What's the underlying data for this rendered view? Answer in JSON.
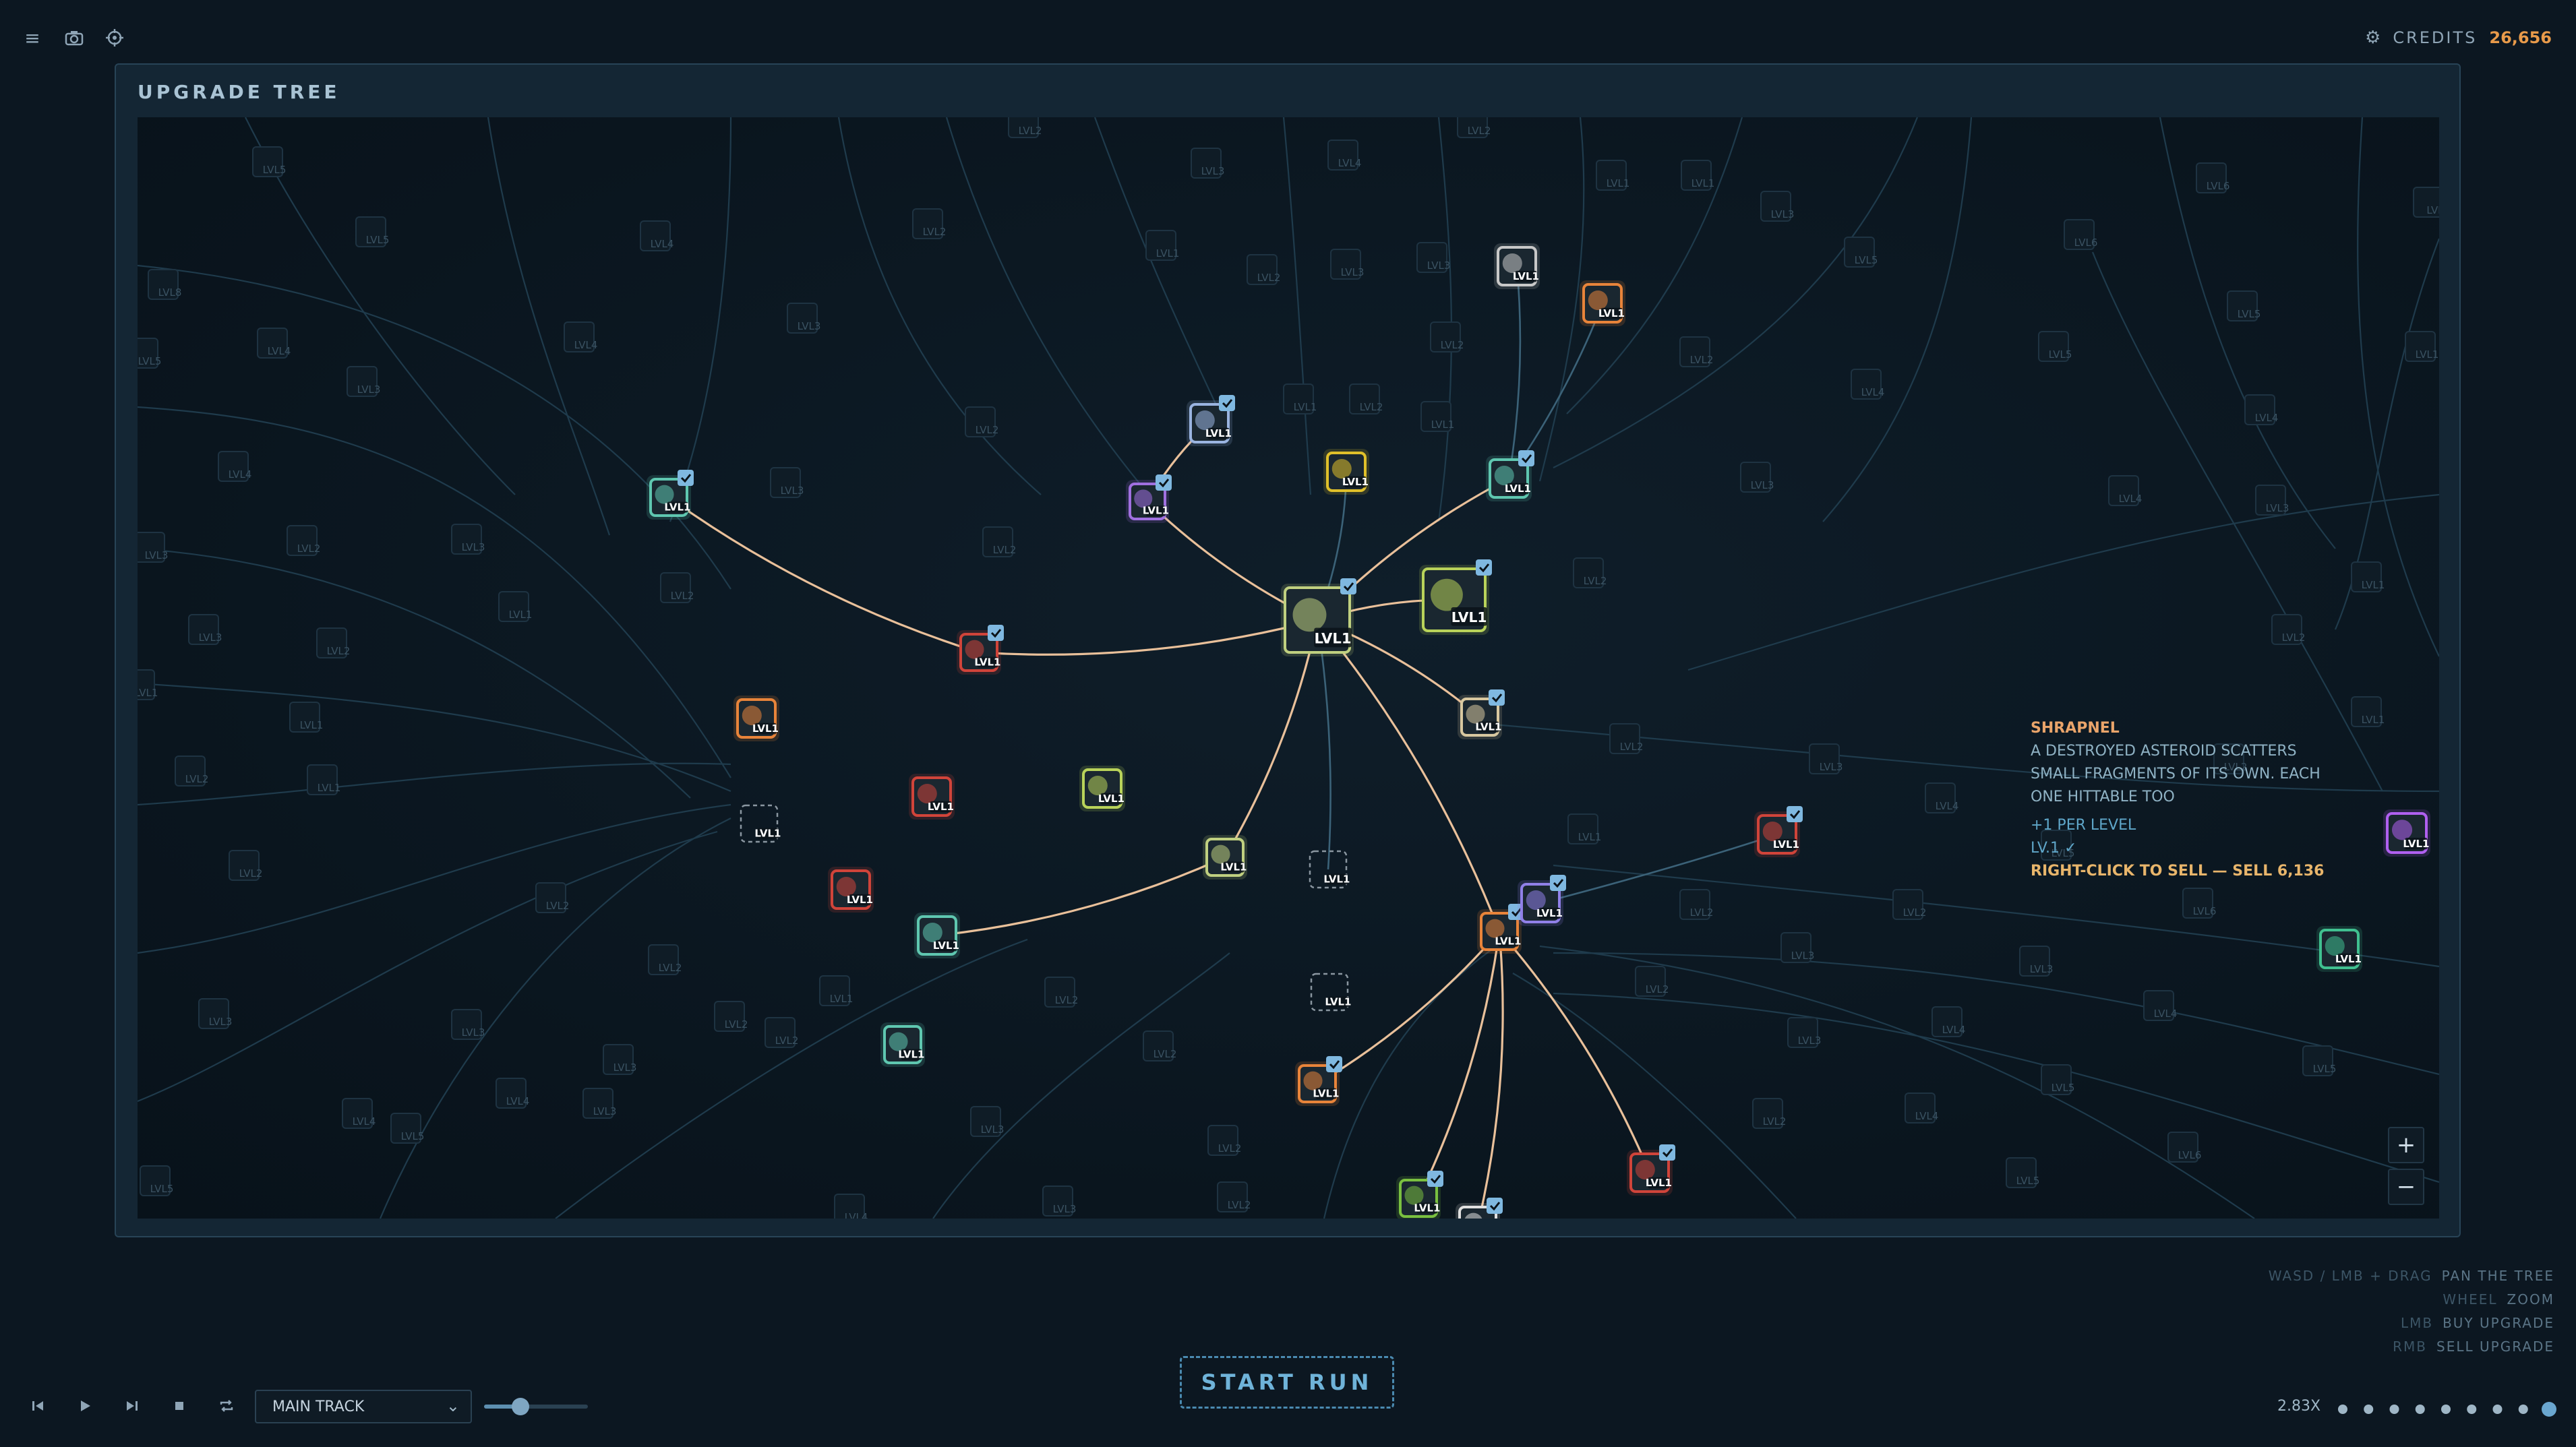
{
  "toolbar": {
    "menu_icon": "menu-icon",
    "camera_icon": "camera-icon",
    "target_icon": "crosshair-icon",
    "credits_label": "CREDITS",
    "credits_value": "26,656",
    "credits_icon": "gear-icon"
  },
  "panel": {
    "title": "UPGRADE TREE"
  },
  "tree": {
    "core": {
      "level": "LVL1"
    },
    "upgrades": [
      {
        "id": "large-green",
        "level": "LVL1",
        "color": "#b9d35a",
        "owned": true
      },
      {
        "id": "top-gray",
        "level": "LVL1",
        "color": "#c8c8c8",
        "owned": false
      },
      {
        "id": "top-orange",
        "level": "LVL1",
        "color": "#e8843a",
        "owned": false
      },
      {
        "id": "purple-left",
        "level": "LVL1",
        "color": "#a070e0",
        "owned": true
      },
      {
        "id": "blue-top",
        "level": "LVL1",
        "color": "#9ab4e0",
        "owned": true
      },
      {
        "id": "gold",
        "level": "LVL1",
        "color": "#e0c02a",
        "owned": false
      },
      {
        "id": "teal-right",
        "level": "LVL1",
        "color": "#5fc7b0",
        "owned": true
      },
      {
        "id": "teal-left",
        "level": "LVL1",
        "color": "#5fc7b0",
        "owned": true
      },
      {
        "id": "red-mid-left",
        "level": "LVL1",
        "color": "#d0443a",
        "owned": true
      },
      {
        "id": "orange-left",
        "level": "LVL1",
        "color": "#e8843a",
        "owned": false
      },
      {
        "id": "red-center",
        "level": "LVL1",
        "color": "#d0443a",
        "owned": false
      },
      {
        "id": "green-small",
        "level": "LVL1",
        "color": "#b9d35a",
        "owned": false
      },
      {
        "id": "dashed-1",
        "level": "LVL1",
        "color": "#8a96a0",
        "owned": false
      },
      {
        "id": "red-lower",
        "level": "LVL1",
        "color": "#d0443a",
        "owned": false
      },
      {
        "id": "olive-hub",
        "level": "LVL1",
        "color": "#c0d080",
        "owned": false
      },
      {
        "id": "teal-lower",
        "level": "LVL1",
        "color": "#5fc7b0",
        "owned": false
      },
      {
        "id": "teal-bottom",
        "level": "LVL1",
        "color": "#5fc7b0",
        "owned": false
      },
      {
        "id": "beige-right",
        "level": "LVL1",
        "color": "#d8c8a0",
        "owned": true
      },
      {
        "id": "dashed-2",
        "level": "LVL1",
        "color": "#8a96a0",
        "owned": false
      },
      {
        "id": "dashed-3",
        "level": "LVL1",
        "color": "#8a96a0",
        "owned": false
      },
      {
        "id": "orange-hub",
        "level": "LVL1",
        "color": "#e8843a",
        "owned": true
      },
      {
        "id": "violet-hub",
        "level": "LVL1",
        "color": "#9080e8",
        "owned": true
      },
      {
        "id": "orange-low",
        "level": "LVL1",
        "color": "#e8843a",
        "owned": true
      },
      {
        "id": "red-right-low",
        "level": "LVL1",
        "color": "#d0443a",
        "owned": true
      },
      {
        "id": "green-bottom",
        "level": "LVL1",
        "color": "#7ac040",
        "owned": true
      },
      {
        "id": "white-bottom",
        "level": "LVL1",
        "color": "#e0e0e0",
        "owned": true
      },
      {
        "id": "red-right",
        "level": "LVL1",
        "color": "#d0443a",
        "owned": true
      },
      {
        "id": "purple-far",
        "level": "LVL1",
        "color": "#b060f0",
        "owned": false
      },
      {
        "id": "green-far",
        "level": "LVL1",
        "color": "#40c090",
        "owned": false
      }
    ],
    "locked_labels": [
      "LVL1",
      "LVL2",
      "LVL3",
      "LVL4",
      "LVL5",
      "LVL6",
      "LVL8"
    ]
  },
  "tooltip": {
    "title": "SHRAPNEL",
    "desc_1": "A DESTROYED ASTEROID SCATTERS",
    "desc_2": "SMALL FRAGMENTS OF ITS OWN. EACH",
    "desc_3": "ONE HITTABLE TOO",
    "per_level": "+1 PER LEVEL",
    "level_line": "LV.1 ✓",
    "sell": "RIGHT-CLICK TO SELL — SELL 6,136"
  },
  "zoom_controls": {
    "plus": "+",
    "minus": "−"
  },
  "start_button": {
    "label": "START RUN"
  },
  "player": {
    "prev_icon": "skip-back-icon",
    "play_icon": "play-icon",
    "next_icon": "skip-forward-icon",
    "stop_icon": "stop-icon",
    "repeat_icon": "repeat-icon",
    "track_selected": "MAIN TRACK",
    "volume": 0.35
  },
  "help": [
    {
      "key": "WASD / LMB + DRAG",
      "action": "PAN THE TREE"
    },
    {
      "key": "WHEEL",
      "action": "ZOOM"
    },
    {
      "key": "LMB",
      "action": "BUY UPGRADE"
    },
    {
      "key": "RMB",
      "action": "SELL UPGRADE"
    }
  ],
  "zoom": {
    "level_text": "2.83X",
    "steps": 9,
    "active_step": 8
  },
  "colors": {
    "accent": "#e89a4a",
    "link": "#e9c09a",
    "line": "#3b6278",
    "tooltip_title": "#e9a46a"
  }
}
